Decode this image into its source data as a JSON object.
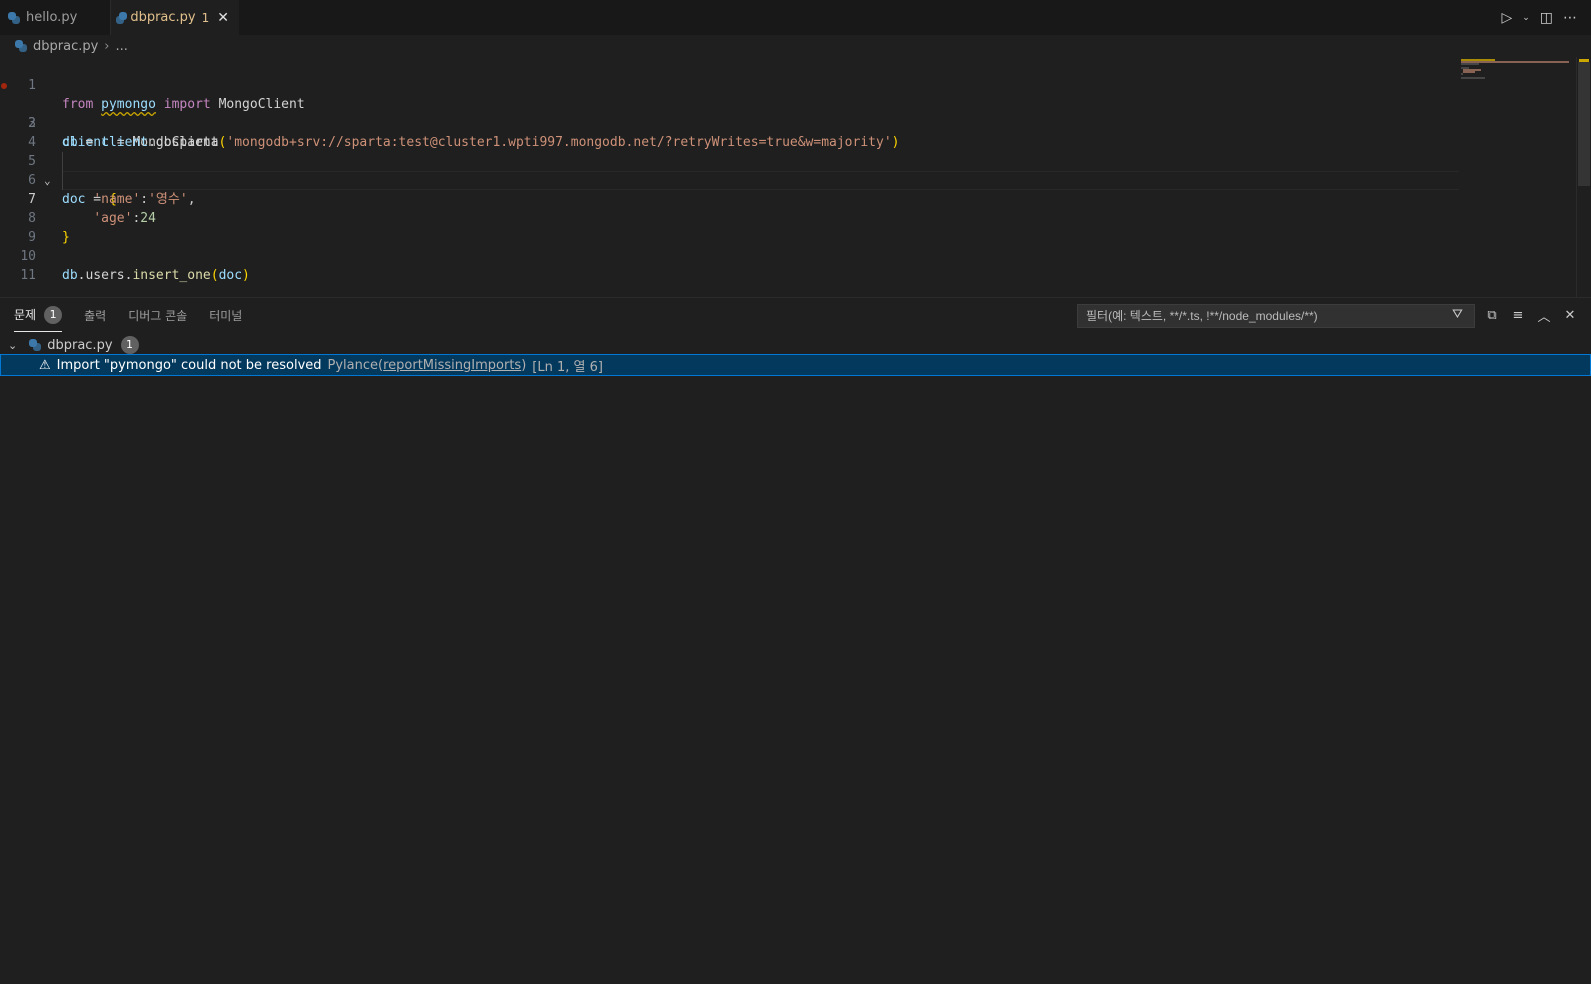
{
  "tabs": [
    {
      "label": "hello.py",
      "active": false
    },
    {
      "label": "dbprac.py",
      "count": "1",
      "active": true
    }
  ],
  "breadcrumb": {
    "file": "dbprac.py",
    "more": "..."
  },
  "editor": {
    "line_numbers": [
      "1",
      "2",
      "3",
      "4",
      "5",
      "6",
      "7",
      "8",
      "9",
      "10",
      "11"
    ],
    "current_line": 7,
    "code": {
      "l1": {
        "from": "from",
        "mod": "pymongo",
        "import": "import",
        "cls": "MongoClient"
      },
      "l2": {
        "var": "client",
        "eq": " = ",
        "cls": "MongoClient",
        "open": "(",
        "str": "'mongodb+srv://sparta:test@cluster1.wpti997.mongodb.net/?retryWrites=true&w=majority'",
        "close": ")"
      },
      "l3": {
        "var": "db",
        "eq": " = ",
        "obj": "client",
        "attr": ".dbsparta"
      },
      "l5": {
        "var": "doc",
        "eq": " = ",
        "open": "{"
      },
      "l6": {
        "key": "'name'",
        "colon": ":",
        "val": "'영수'",
        "comma": ","
      },
      "l7": {
        "key": "'age'",
        "colon": ":",
        "val": "24"
      },
      "l8": {
        "close": "}"
      },
      "l10": {
        "obj": "db",
        "attr": ".users.",
        "fn": "insert_one",
        "open": "(",
        "arg": "doc",
        "close": ")"
      }
    }
  },
  "panel": {
    "tabs": [
      {
        "label": "문제",
        "badge": "1"
      },
      {
        "label": "출력"
      },
      {
        "label": "디버그 콘솔"
      },
      {
        "label": "터미널"
      }
    ],
    "filter_placeholder": "필터(예: 텍스트, **/*.ts, !**/node_modules/**)",
    "problems": {
      "file": "dbprac.py",
      "count": "1",
      "message": "Import \"pymongo\" could not be resolved",
      "source": "Pylance(",
      "code": "reportMissingImports",
      "source_close": ")",
      "position": "[Ln 1, 열 6]"
    }
  },
  "colors": {
    "accent": "#0078d4",
    "warning": "#cca700",
    "selection": "#04395e",
    "modified_tab": "#e2c08d"
  }
}
